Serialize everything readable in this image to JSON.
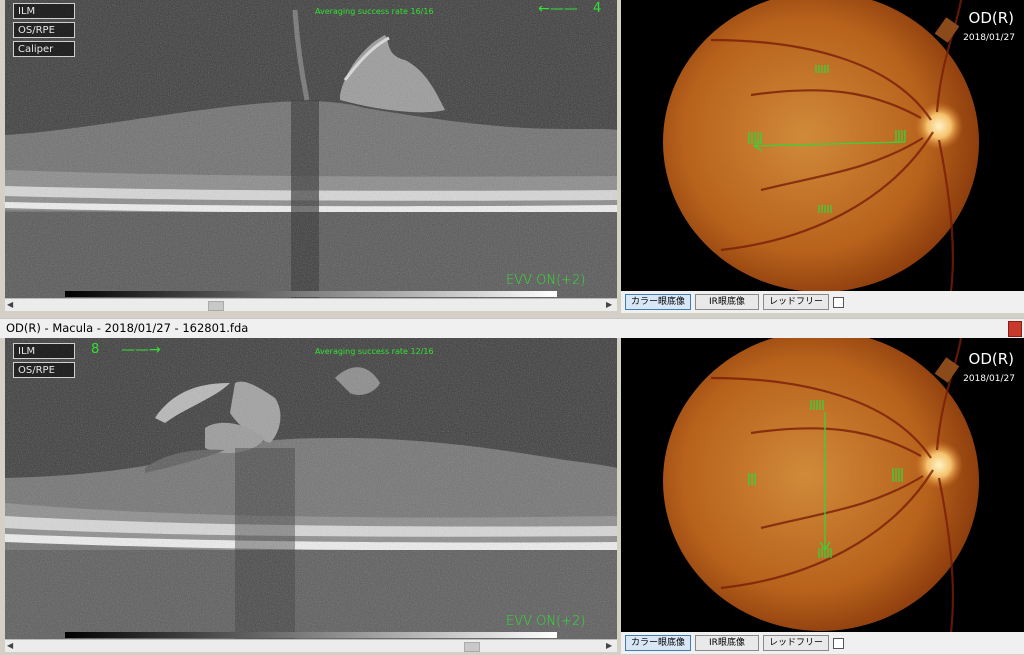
{
  "top": {
    "layer_buttons": [
      "ILM",
      "OS/RPE",
      "Caliper"
    ],
    "avg_text": "Averaging success rate  16/16",
    "arrow_count": "4",
    "evv": "EVV ON(+2)",
    "eye": "OD(R)",
    "date": "2018/01/27"
  },
  "titlebar": {
    "text": "OD(R) - Macula - 2018/01/27 - 162801.fda"
  },
  "bottom": {
    "layer_buttons": [
      "ILM",
      "OS/RPE"
    ],
    "avg_text": "Averaging success rate  12/16",
    "arrow_count": "8",
    "evv": "EVV ON(+2)",
    "eye": "OD(R)",
    "date": "2018/01/27"
  },
  "fundus_buttons": {
    "color": "カラー眼底像",
    "ir": "IR眼底像",
    "redfree": "レッドフリー"
  },
  "accent_color": "#33e033"
}
